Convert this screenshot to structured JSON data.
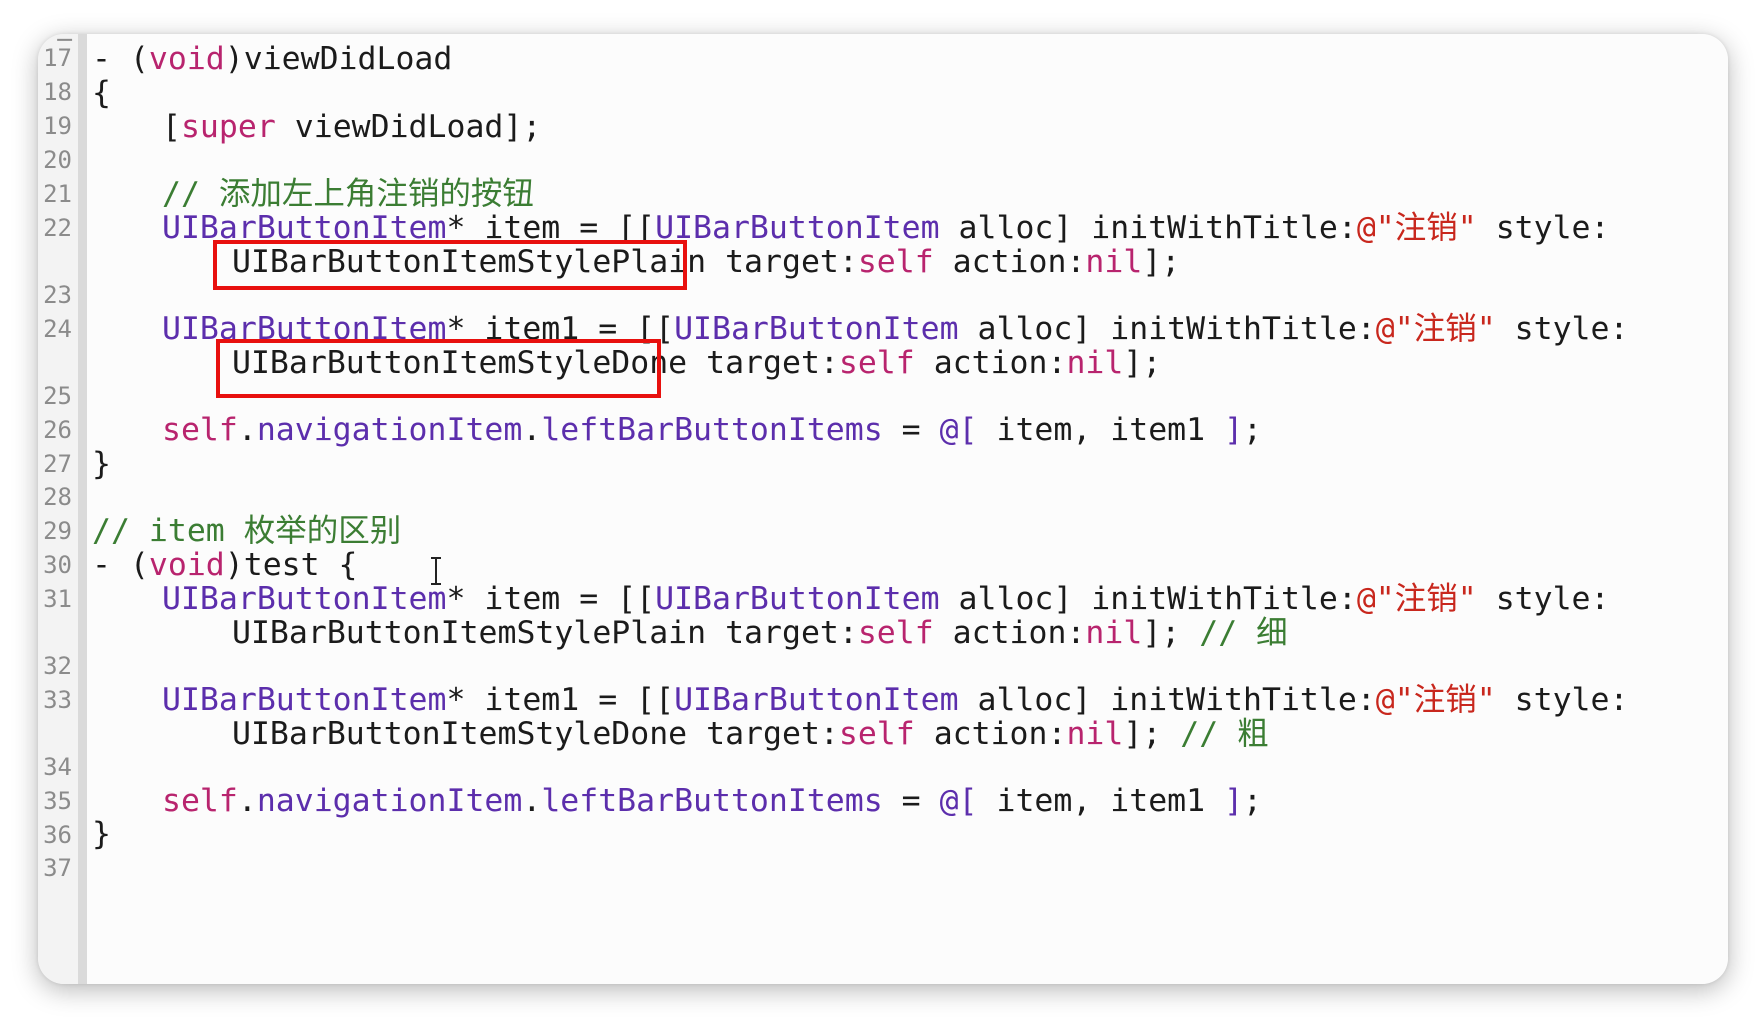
{
  "gutter": {
    "line_numbers": [
      "17",
      "18",
      "19",
      "20",
      "21",
      "22",
      "23",
      "24",
      "25",
      "26",
      "27",
      "28",
      "29",
      "30",
      "31",
      "32",
      "33",
      "34",
      "35",
      "36",
      "37"
    ]
  },
  "code": {
    "l17": {
      "dash": "- (",
      "void": "void",
      "name": ")viewDidLoad"
    },
    "l18": {
      "brace": "{"
    },
    "l19": {
      "open": "[",
      "super": "super",
      "rest": " viewDidLoad];"
    },
    "l21": {
      "comment": "// 添加左上角注销的按钮"
    },
    "l22": {
      "type": "UIBarButtonItem",
      "decl": "* item = [[",
      "cls": "UIBarButtonItem",
      "alloc": " alloc] initWithTitle:",
      "str": "@\"注销\"",
      "style": " style:"
    },
    "l22b": {
      "style_val": "UIBarButtonItemStylePlain",
      "target": " target:",
      "self": "self",
      "action": " action:",
      "nil": "nil",
      "end": "];"
    },
    "l24": {
      "type": "UIBarButtonItem",
      "decl": "* item1 = [[",
      "cls": "UIBarButtonItem",
      "alloc": " alloc] initWithTitle:",
      "str": "@\"注销\"",
      "style": " style:"
    },
    "l24b": {
      "style_val": "UIBarButtonItemStyleDone",
      "target": " target:",
      "self": "self",
      "action": " action:",
      "nil": "nil",
      "end": "];"
    },
    "l26": {
      "self": "self",
      "dot1": ".",
      "nav": "navigationItem",
      "dot2": ".",
      "left": "leftBarButtonItems",
      "eq": " = ",
      "at": "@[",
      "items": " item, item1 ",
      "close": "]",
      "semi": ";"
    },
    "l27": {
      "brace": "}"
    },
    "l29": {
      "comment": "// item 枚举的区别"
    },
    "l30": {
      "dash": "- (",
      "void": "void",
      "name": ")test {"
    },
    "l31": {
      "type": "UIBarButtonItem",
      "decl": "* item = [[",
      "cls": "UIBarButtonItem",
      "alloc": " alloc] initWithTitle:",
      "str": "@\"注销\"",
      "style": " style:"
    },
    "l31b": {
      "style_val": "UIBarButtonItemStylePlain",
      "target": " target:",
      "self": "self",
      "action": " action:",
      "nil": "nil",
      "end": "]; ",
      "comment": "// 细"
    },
    "l33": {
      "type": "UIBarButtonItem",
      "decl": "* item1 = [[",
      "cls": "UIBarButtonItem",
      "alloc": " alloc] initWithTitle:",
      "str": "@\"注销\"",
      "style": " style:"
    },
    "l33b": {
      "style_val": "UIBarButtonItemStyleDone",
      "target": " target:",
      "self": "self",
      "action": " action:",
      "nil": "nil",
      "end": "]; ",
      "comment": "// 粗"
    },
    "l35": {
      "self": "self",
      "dot1": ".",
      "nav": "navigationItem",
      "dot2": ".",
      "left": "leftBarButtonItems",
      "eq": " = ",
      "at": "@[",
      "items": " item, item1 ",
      "close": "]",
      "semi": ";"
    },
    "l36": {
      "brace": "}"
    }
  },
  "highlights": {
    "color": "#e8100e",
    "boxed_tokens": [
      "UIBarButtonItemStylePlain",
      "UIBarButtonItemStyleDone"
    ]
  },
  "colors": {
    "keyword": "#b8246e",
    "type": "#5c2eac",
    "string": "#c8271d",
    "comment": "#3b7d33",
    "plain": "#1b1b1b",
    "line_number": "#8b8b8b"
  },
  "cursor_icon": "text-ibeam-icon"
}
